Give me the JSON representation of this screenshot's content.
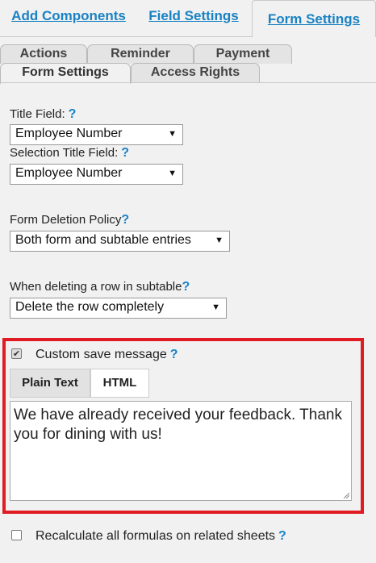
{
  "top_tabs": [
    "Add Components",
    "Field Settings",
    "Form Settings"
  ],
  "sub_tabs_row1": [
    "Actions",
    "Reminder",
    "Payment"
  ],
  "sub_tabs_row2": [
    "Form Settings",
    "Access Rights"
  ],
  "help_glyph": "?",
  "title_field": {
    "label": "Title Field:",
    "value": "Employee Number"
  },
  "selection_title_field": {
    "label": "Selection Title Field:",
    "value": "Employee Number"
  },
  "deletion_policy": {
    "label": "Form Deletion Policy",
    "value": "Both form and subtable entries"
  },
  "subtable_delete": {
    "label": "When deleting a row in subtable",
    "value": "Delete the row completely"
  },
  "custom_save": {
    "label": "Custom save message",
    "checked": true,
    "tabs": [
      "Plain Text",
      "HTML"
    ],
    "active_tab": "Plain Text",
    "message": "We have already received your feedback. Thank you for dining with us!"
  },
  "recalculate": {
    "label": "Recalculate all formulas on related sheets",
    "checked": false
  },
  "colors": {
    "accent": "#1a82c4",
    "highlight_border": "#e01b24"
  }
}
